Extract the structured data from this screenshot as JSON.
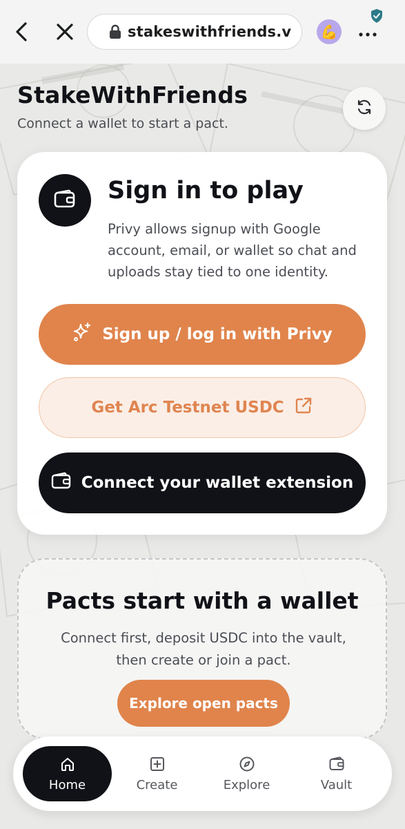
{
  "browser": {
    "url": "stakeswithfriends.v",
    "avatar_emoji": "💪",
    "icons": [
      "back-arrow-icon",
      "close-icon",
      "lock-icon",
      "more-icon",
      "shield-check-icon"
    ]
  },
  "header": {
    "title": "StakeWithFriends",
    "subtitle": "Connect a wallet to start a pact.",
    "refresh_icon": "refresh-icon"
  },
  "signin": {
    "icon": "wallet-icon",
    "title": "Sign in to play",
    "description": "Privy allows signup with Google account, email, or wallet so chat and uploads stay tied to one identity.",
    "privy_button": "Sign up / log in with Privy",
    "usdc_button": "Get Arc Testnet USDC",
    "wallet_button": "Connect your wallet extension"
  },
  "pacts": {
    "title": "Pacts start with a wallet",
    "description": "Connect first, deposit USDC into the vault, then create or join a pact.",
    "explore_button": "Explore open pacts"
  },
  "nav": {
    "items": [
      {
        "label": "Home",
        "icon": "home-icon",
        "active": true
      },
      {
        "label": "Create",
        "icon": "plus-square-icon",
        "active": false
      },
      {
        "label": "Explore",
        "icon": "compass-icon",
        "active": false
      },
      {
        "label": "Vault",
        "icon": "wallet-icon",
        "active": false
      }
    ]
  },
  "colors": {
    "accent": "#e0844c",
    "dark": "#111217",
    "light_accent_bg": "#fbeee6"
  }
}
